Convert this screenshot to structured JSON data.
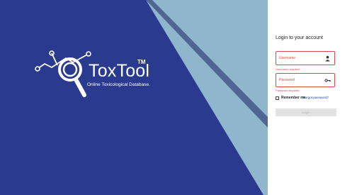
{
  "brand": {
    "name": "ToxTool",
    "trademark": "TM",
    "tagline": "Online Toxicological Database."
  },
  "login": {
    "title": "Login to your account",
    "username": {
      "placeholder": "Username",
      "value": "",
      "error": "Username required",
      "icon": "person-icon"
    },
    "password": {
      "placeholder": "Password",
      "value": "",
      "error": "Password required",
      "icon": "key-icon"
    },
    "remember_label": "Remember me",
    "remember_checked": false,
    "forgot_label": "Forgot password?",
    "submit_label": "Login"
  },
  "colors": {
    "background_dark_blue": "#2a3a8f",
    "background_light_blue": "#8fb6cd",
    "panel": "#ffffff",
    "error": "#d94a4a",
    "link": "#1c3da3",
    "button_disabled": "#e2e2e2"
  }
}
